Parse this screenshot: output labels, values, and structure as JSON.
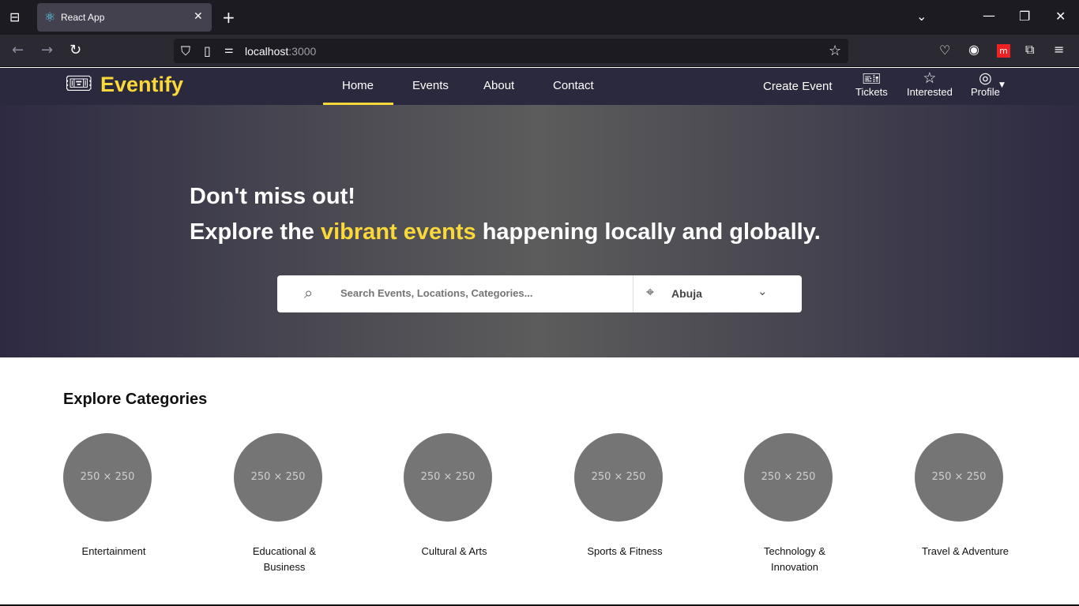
{
  "browser": {
    "tab_title": "React App",
    "url_host": "localhost",
    "url_port": ":3000"
  },
  "nav": {
    "logo": "Eventify",
    "links": [
      "Home",
      "Events",
      "About",
      "Contact"
    ],
    "create_event": "Create Event",
    "tickets": "Tickets",
    "interested": "Interested",
    "profile": "Profile"
  },
  "hero": {
    "line1": "Don't miss out!",
    "line2_pre": "Explore the ",
    "line2_highlight": "vibrant events",
    "line2_post": " happening locally and globally.",
    "search_placeholder": "Search Events, Locations, Categories...",
    "location": "Abuja"
  },
  "categories": {
    "title": "Explore Categories",
    "placeholder": "250 × 250",
    "items": [
      "Entertainment",
      "Educational & Business",
      "Cultural & Arts",
      "Sports & Fitness",
      "Technology & Innovation",
      "Travel & Adventure"
    ]
  },
  "colors": {
    "accent": "#fbd83a",
    "nav": "#2b293d"
  }
}
